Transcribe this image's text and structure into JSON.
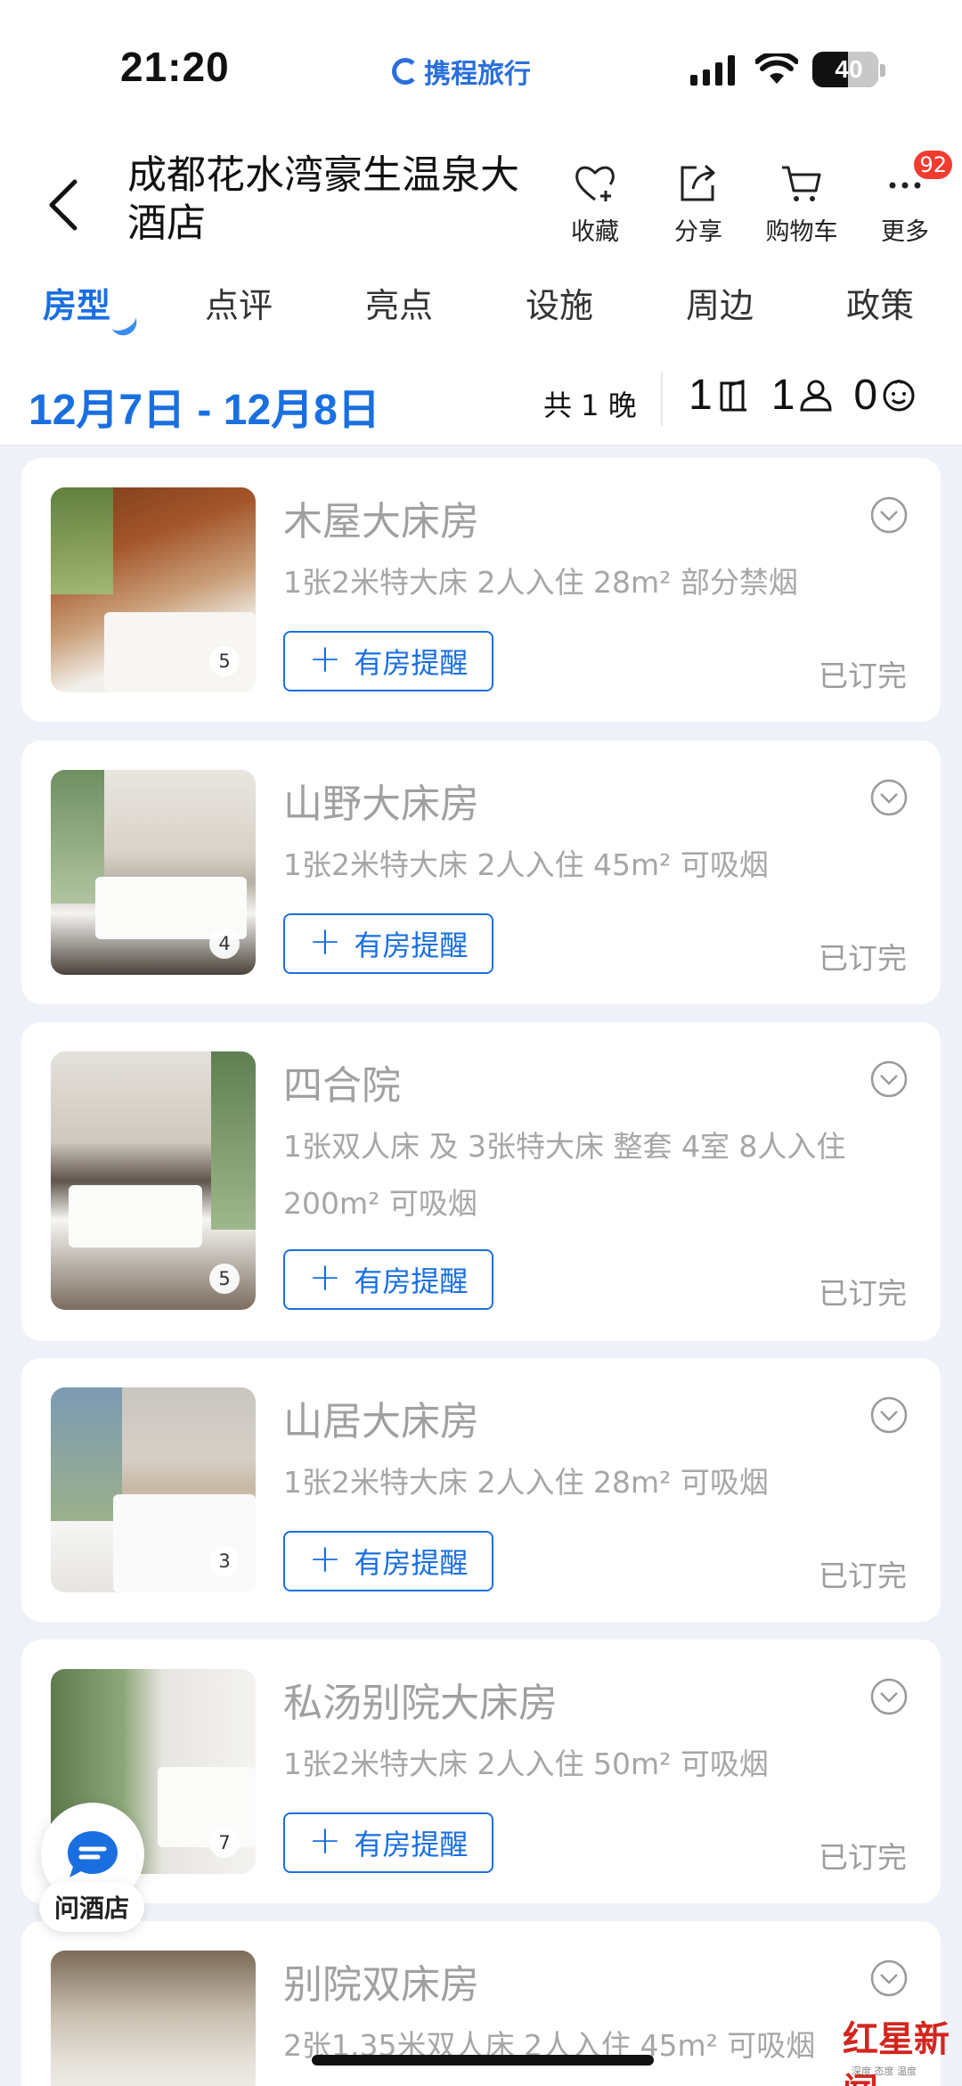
{
  "status_bar": {
    "time": "21:20",
    "brand": "携程旅行",
    "battery": "40"
  },
  "header": {
    "title": "成都花水湾豪生温泉大酒店",
    "actions": [
      {
        "label": "收藏",
        "icon": "heart-plus-icon"
      },
      {
        "label": "分享",
        "icon": "share-icon"
      },
      {
        "label": "购物车",
        "icon": "cart-icon"
      },
      {
        "label": "更多",
        "icon": "more-icon",
        "badge": "92"
      }
    ]
  },
  "tabs": [
    "房型",
    "点评",
    "亮点",
    "设施",
    "周边",
    "政策"
  ],
  "active_tab": "房型",
  "date_bar": {
    "range": "12月7日 - 12月8日",
    "nights": "共 1 晚",
    "rooms": "1",
    "adults": "1",
    "children": "0"
  },
  "rooms": [
    {
      "name": "木屋大床房",
      "desc": "1张2米特大床  2人入住  28m²  部分禁烟",
      "photos": "5",
      "remind": "有房提醒",
      "status": "已订完"
    },
    {
      "name": "山野大床房",
      "desc": "1张2米特大床  2人入住  45m²  可吸烟",
      "photos": "4",
      "remind": "有房提醒",
      "status": "已订完"
    },
    {
      "name": "四合院",
      "desc": "1张双人床 及 3张特大床  整套  4室  8人入住  200m²  可吸烟",
      "photos": "5",
      "remind": "有房提醒",
      "status": "已订完"
    },
    {
      "name": "山居大床房",
      "desc": "1张2米特大床  2人入住  28m²  可吸烟",
      "photos": "3",
      "remind": "有房提醒",
      "status": "已订完"
    },
    {
      "name": "私汤别院大床房",
      "desc": "1张2米特大床  2人入住  50m²  可吸烟",
      "photos": "7",
      "remind": "有房提醒",
      "status": "已订完"
    },
    {
      "name": "别院双床房",
      "desc": "2张1.35米双人床  2人入住  45m²  可吸烟",
      "photos": "",
      "remind": "",
      "status": ""
    }
  ],
  "floating": {
    "label": "问酒店"
  },
  "watermark": {
    "main": "红星新闻",
    "sub": "深度 态度 温度"
  },
  "colors": {
    "accent": "#1a6fe0",
    "badge": "#f23b2f",
    "muted": "#a0a0a0"
  }
}
